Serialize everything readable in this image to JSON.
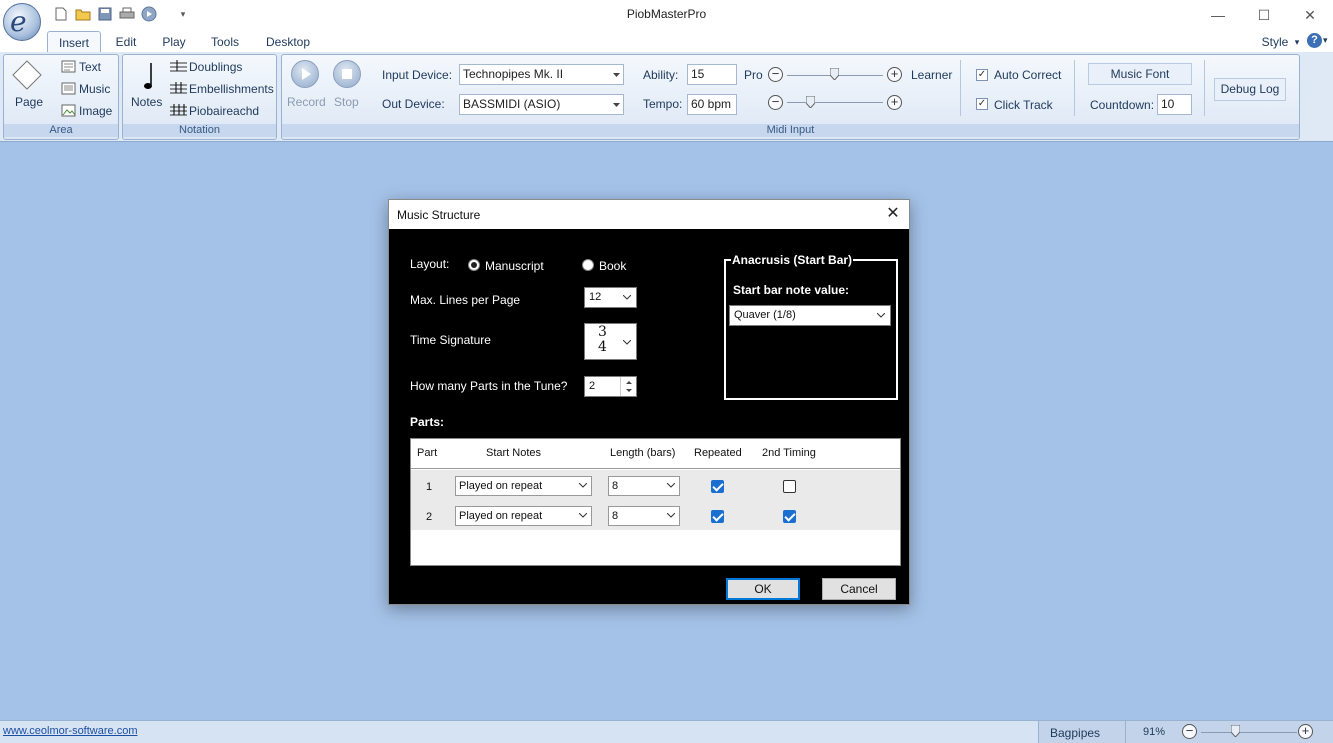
{
  "window": {
    "title": "PiobMasterPro",
    "controls": {
      "minimize": "—",
      "maximize": "☐",
      "close": "✕"
    }
  },
  "quick_access": [
    "new-file-icon",
    "open-folder-icon",
    "save-icon",
    "print-icon",
    "play-circle-icon",
    "customize-dropdown-icon"
  ],
  "tabs": [
    "Insert",
    "Edit",
    "Play",
    "Tools",
    "Desktop"
  ],
  "style_menu": {
    "label": "Style",
    "help": "?"
  },
  "ribbon": {
    "area": {
      "label": "Area",
      "page": "Page",
      "text": "Text",
      "music": "Music",
      "image": "Image"
    },
    "notation": {
      "label": "Notation",
      "notes": "Notes",
      "doublings": "Doublings",
      "embellishments": "Embellishments",
      "piobaireachd": "Piobaireachd"
    },
    "midi": {
      "label": "Midi Input",
      "record": "Record",
      "stop": "Stop",
      "input_device_label": "Input Device:",
      "input_device_value": "Technopipes Mk. II",
      "out_device_label": "Out Device:",
      "out_device_value": "BASSMIDI (ASIO)",
      "ability_label": "Ability:",
      "ability_value": "15",
      "pro_label": "Pro",
      "learner_label": "Learner",
      "tempo_label": "Tempo:",
      "tempo_value": "60 bpm",
      "auto_correct": "Auto Correct",
      "auto_correct_checked": true,
      "click_track": "Click Track",
      "click_track_checked": true,
      "music_font": "Music Font",
      "countdown_label": "Countdown:",
      "countdown_value": "10",
      "debug_log": "Debug Log"
    }
  },
  "dialog": {
    "title": "Music Structure",
    "close": "✕",
    "layout_label": "Layout:",
    "layout_options": [
      "Manuscript",
      "Book"
    ],
    "layout_selected": "Manuscript",
    "max_lines_label": "Max. Lines per Page",
    "max_lines_value": "12",
    "time_sig_label": "Time Signature",
    "time_sig_top": "3",
    "time_sig_bottom": "4",
    "parts_count_label": "How many Parts in the Tune?",
    "parts_count_value": "2",
    "parts_label": "Parts:",
    "anacrusis": {
      "title": "Anacrusis (Start Bar)",
      "note_value_label": "Start bar note value:",
      "note_value": "Quaver (1/8)"
    },
    "grid": {
      "columns": [
        "Part",
        "Start Notes",
        "Length (bars)",
        "Repeated",
        "2nd Timing"
      ],
      "rows": [
        {
          "part": "1",
          "start_notes": "Played on repeat",
          "length": "8",
          "repeated": true,
          "second_timing": false
        },
        {
          "part": "2",
          "start_notes": "Played on repeat",
          "length": "8",
          "repeated": true,
          "second_timing": true
        }
      ]
    },
    "ok": "OK",
    "cancel": "Cancel"
  },
  "statusbar": {
    "website": "www.ceolmor-software.com",
    "instrument": "Bagpipes",
    "zoom": "91%",
    "zoom_fraction": 0.35
  }
}
